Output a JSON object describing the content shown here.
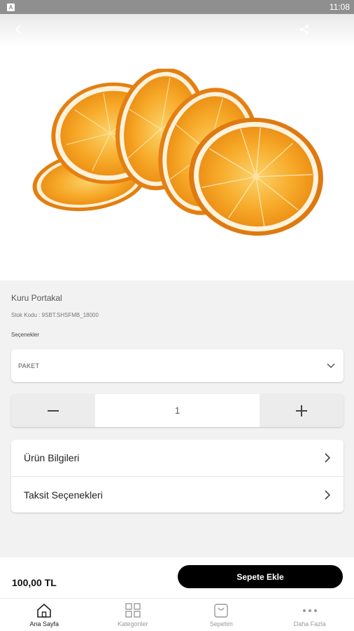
{
  "status_bar": {
    "time": "11:08",
    "notification_icon": "app-notification-icon"
  },
  "header": {
    "back_icon": "back-chevron-icon",
    "share_icon": "share-icon"
  },
  "product": {
    "image_icon": "dried-orange-slices-image",
    "name": "Kuru Portakal",
    "stock_code": "Stok Kodu : 9SBT.SHSFMB_18000",
    "options_label": "Seçenekler",
    "selected_option": "PAKET",
    "quantity": "1",
    "info_rows": [
      {
        "label": "Ürün Bilgileri"
      },
      {
        "label": "Taksit Seçenekleri"
      }
    ]
  },
  "checkout": {
    "price": "100,00 TL",
    "add_to_cart": "Sepete Ekle"
  },
  "tabs": [
    {
      "label": "Ana Sayfa",
      "icon": "home-icon",
      "active": true
    },
    {
      "label": "Kategoriler",
      "icon": "grid-icon",
      "active": false
    },
    {
      "label": "Sepetim",
      "icon": "cart-icon",
      "active": false
    },
    {
      "label": "Daha Fazla",
      "icon": "more-icon",
      "active": false
    }
  ],
  "colors": {
    "accent": "#000000",
    "background": "#f2f2f2",
    "status_bar": "#8f8f8f",
    "orange": "#f5a11f"
  }
}
